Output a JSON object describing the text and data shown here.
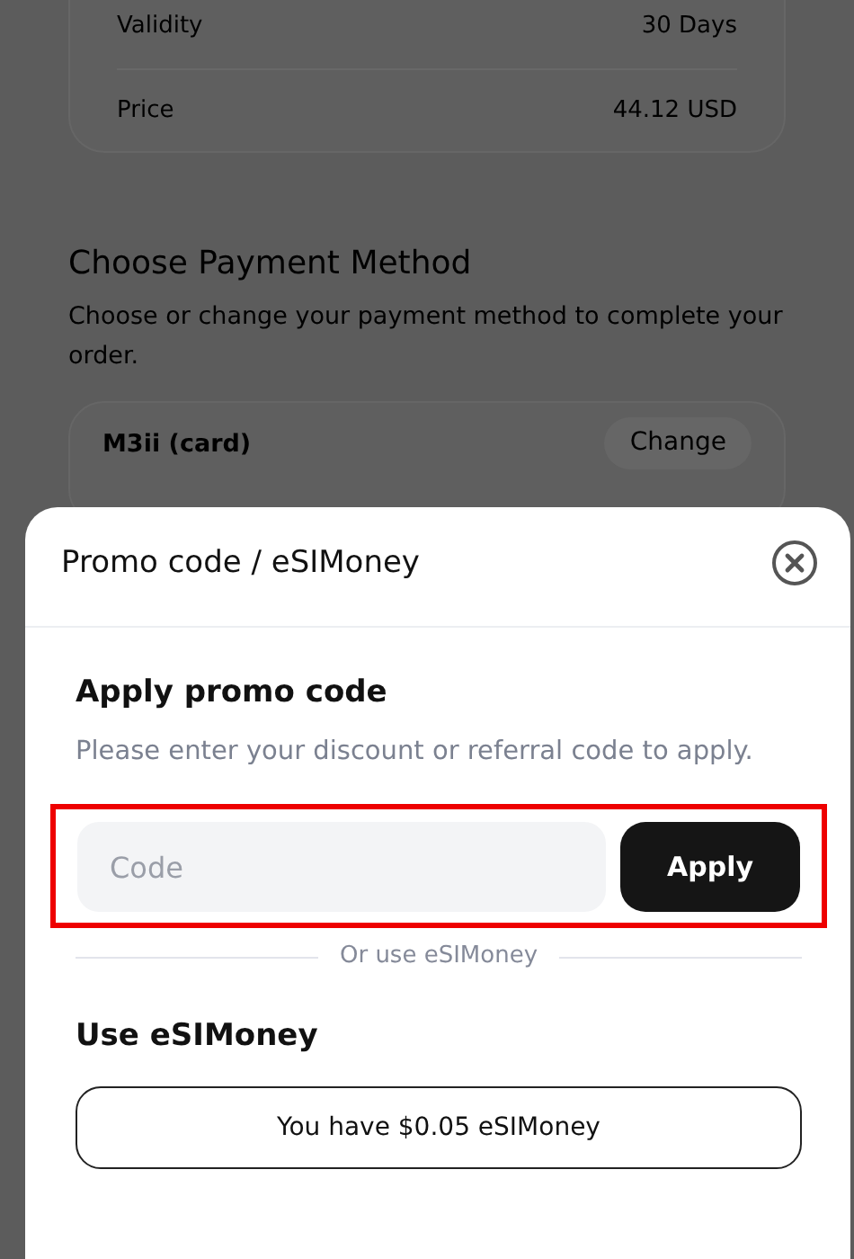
{
  "order_summary": {
    "rows": [
      {
        "label": "Validity",
        "value": "30 Days"
      },
      {
        "label": "Price",
        "value": "44.12 USD"
      }
    ]
  },
  "payment": {
    "title": "Choose Payment Method",
    "description": "Choose or change your payment method to complete your order.",
    "method": "M3ii (card)",
    "change_button": "Change"
  },
  "modal": {
    "title": "Promo code / eSIMoney",
    "promo": {
      "title": "Apply promo code",
      "description": "Please enter your discount or referral code to apply.",
      "placeholder": "Code",
      "apply_button": "Apply",
      "highlighted": true
    },
    "divider_text": "Or use eSIMoney",
    "esimoney": {
      "title": "Use eSIMoney",
      "balance_button": "You have $0.05 eSIMoney"
    }
  }
}
